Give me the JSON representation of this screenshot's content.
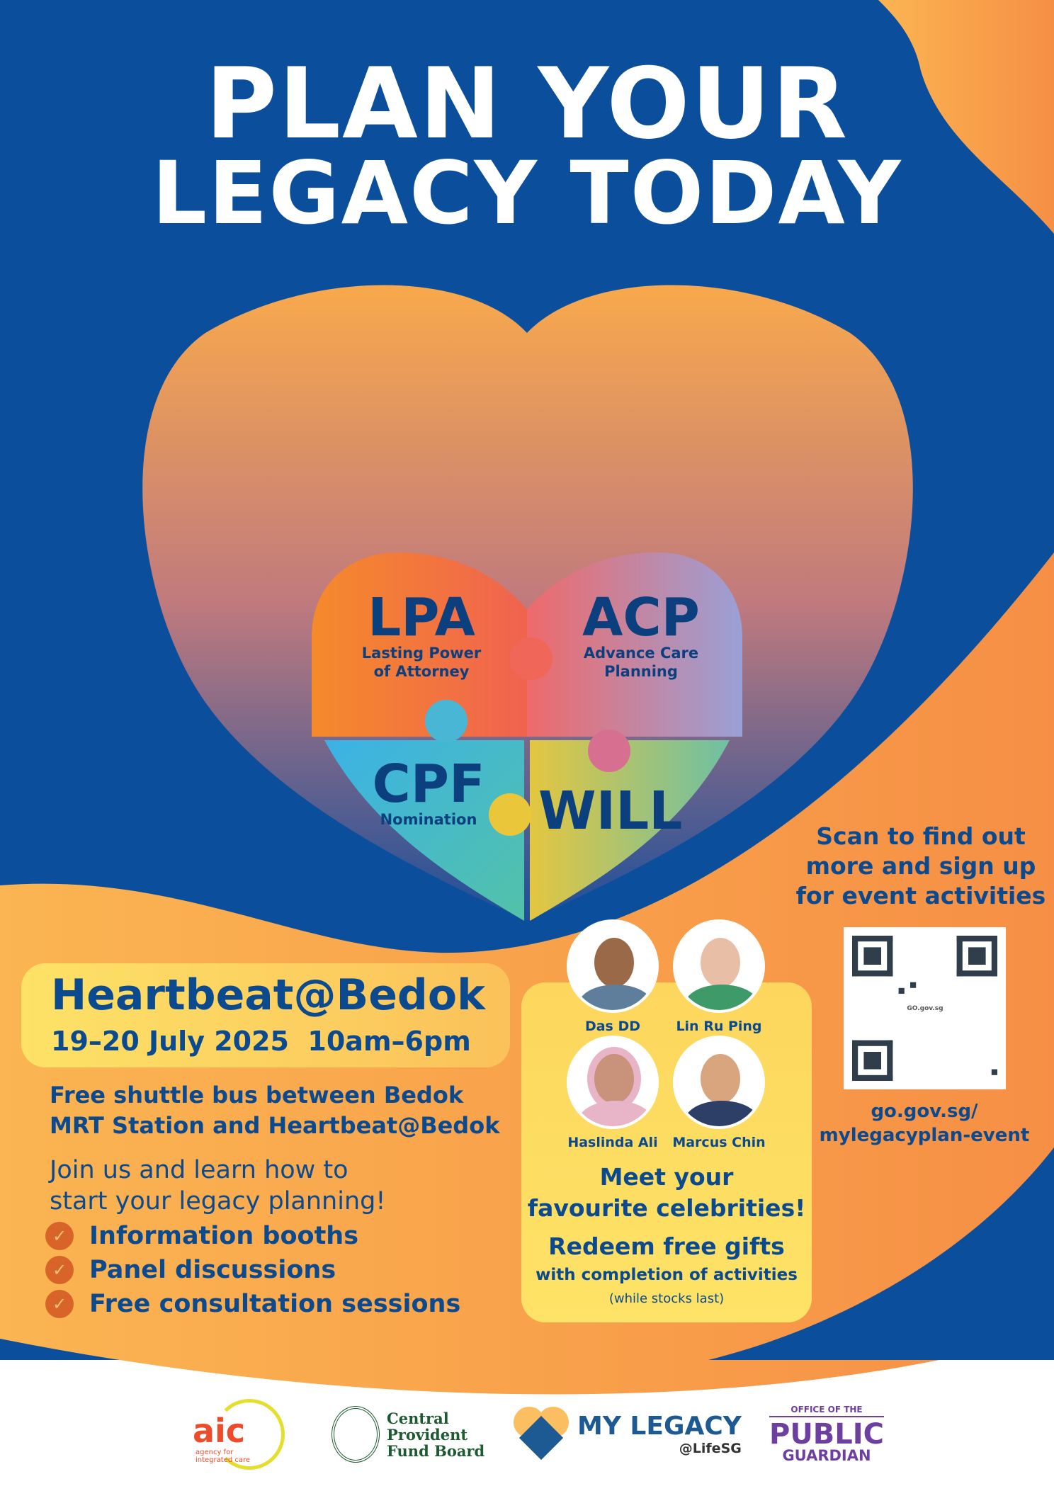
{
  "title": {
    "line1": "PLAN YOUR",
    "line2": "LEGACY TODAY"
  },
  "puzzle": [
    {
      "code": "LPA",
      "desc1": "Lasting Power",
      "desc2": "of Attorney"
    },
    {
      "code": "ACP",
      "desc1": "Advance Care",
      "desc2": "Planning"
    },
    {
      "code": "CPF",
      "desc1": "Nomination"
    },
    {
      "code": "WILL"
    }
  ],
  "event": {
    "venue": "Heartbeat@Bedok",
    "dates": "19–20 July 2025  10am–6pm",
    "shuttle1": "Free shuttle bus between Bedok",
    "shuttle2": "MRT Station and Heartbeat@Bedok",
    "join1": "Join us and learn how to",
    "join2": "start your legacy planning!",
    "activities": [
      "Information booths",
      "Panel discussions",
      "Free consultation sessions"
    ]
  },
  "celebrities": [
    {
      "name": "Das DD"
    },
    {
      "name": "Lin Ru Ping"
    },
    {
      "name": "Haslinda Ali"
    },
    {
      "name": "Marcus Chin"
    }
  ],
  "celeb_box": {
    "meet1": "Meet your",
    "meet2": "favourite celebrities!",
    "redeem": "Redeem free gifts",
    "redeem_sub": "with completion of activities",
    "note": "(while stocks last)"
  },
  "scan": {
    "line1": "Scan to find out",
    "line2": "more and sign up",
    "line3": "for event activities",
    "qr_badge": "GO.gov.sg",
    "url1": "go.gov.sg/",
    "url2": "mylegacyplan-event"
  },
  "logos": {
    "aic": "aic",
    "aic_sub1": "agency for",
    "aic_sub2": "integrated care",
    "cpf1": "Central",
    "cpf2": "Provident",
    "cpf3": "Fund Board",
    "mylegacy": "MY LEGACY",
    "lifesg": "@LifeSG",
    "opg1": "OFFICE OF THE",
    "opg2": "PUBLIC",
    "opg3": "GUARDIAN"
  },
  "colors": {
    "blue": "#0b4f9c",
    "orange": "#f7a24b",
    "navy_text": "#0b4a8f"
  }
}
